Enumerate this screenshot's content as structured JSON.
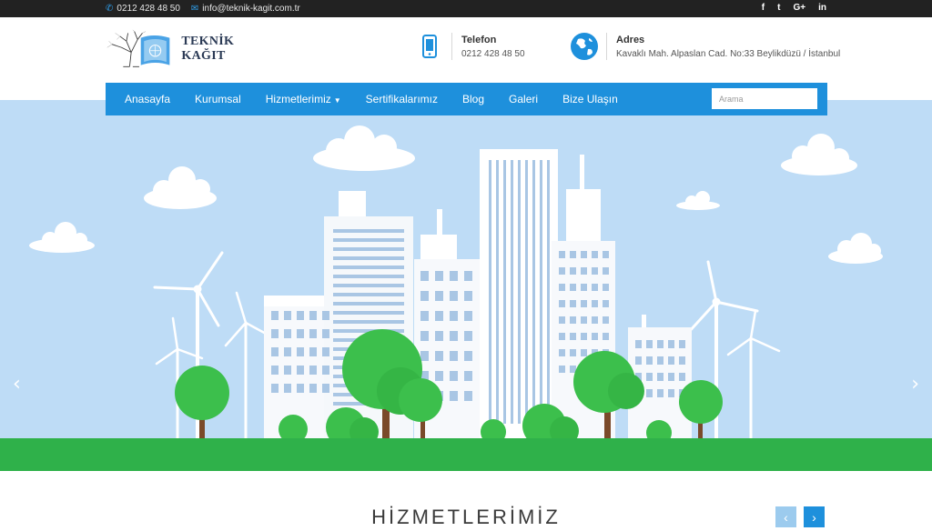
{
  "topbar": {
    "phone": "0212 428 48 50",
    "email": "info@teknik-kagit.com.tr",
    "social": [
      {
        "icon": "facebook-icon",
        "glyph": "f"
      },
      {
        "icon": "twitter-icon",
        "glyph": "t"
      },
      {
        "icon": "google-plus-icon",
        "glyph": "G+"
      },
      {
        "icon": "linkedin-icon",
        "glyph": "in"
      }
    ]
  },
  "header": {
    "logo_text": "TEKNİK KAĞIT",
    "phone_label": "Telefon",
    "phone_value": "0212 428 48 50",
    "address_label": "Adres",
    "address_value": "Kavaklı Mah. Alpaslan Cad. No:33 Beylikdüzü / İstanbul"
  },
  "nav": {
    "items": [
      {
        "label": "Anasayfa"
      },
      {
        "label": "Kurumsal"
      },
      {
        "label": "Hizmetlerimiz",
        "dropdown": true
      },
      {
        "label": "Sertifikalarımız"
      },
      {
        "label": "Blog"
      },
      {
        "label": "Galeri"
      },
      {
        "label": "Bize Ulaşın"
      }
    ],
    "search_placeholder": "Arama"
  },
  "slider": {
    "prev_glyph": "‹",
    "next_glyph": "›"
  },
  "section": {
    "title": "HİZMETLERİMİZ",
    "prev_glyph": "‹",
    "next_glyph": "›"
  },
  "colors": {
    "topbar": "#222222",
    "accent": "#1e90dc",
    "sky": "#bedcf6",
    "grass": "#2fb14a",
    "tree": "#3cbf4c"
  }
}
